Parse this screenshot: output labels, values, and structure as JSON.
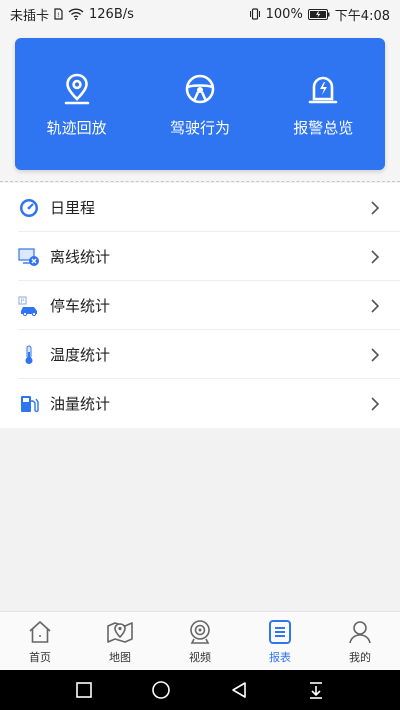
{
  "status_bar": {
    "carrier": "未插卡",
    "speed": "126B/s",
    "battery": "100%",
    "time": "下午4:08"
  },
  "quick_actions": [
    {
      "label": "轨迹回放",
      "icon": "location-pin-icon"
    },
    {
      "label": "驾驶行为",
      "icon": "steering-wheel-icon"
    },
    {
      "label": "报警总览",
      "icon": "alarm-light-icon"
    }
  ],
  "report_list": [
    {
      "label": "日里程",
      "icon": "mileage-gauge-icon"
    },
    {
      "label": "离线统计",
      "icon": "offline-monitor-icon"
    },
    {
      "label": "停车统计",
      "icon": "parking-car-icon"
    },
    {
      "label": "温度统计",
      "icon": "thermometer-icon"
    },
    {
      "label": "油量统计",
      "icon": "fuel-pump-icon"
    }
  ],
  "tabs": [
    {
      "label": "首页",
      "icon": "home-icon",
      "active": false
    },
    {
      "label": "地图",
      "icon": "map-icon",
      "active": false
    },
    {
      "label": "视频",
      "icon": "camera-icon",
      "active": false
    },
    {
      "label": "报表",
      "icon": "report-icon",
      "active": true
    },
    {
      "label": "我的",
      "icon": "profile-icon",
      "active": false
    }
  ],
  "colors": {
    "primary": "#2f74f0",
    "background": "#f2f2f2"
  }
}
